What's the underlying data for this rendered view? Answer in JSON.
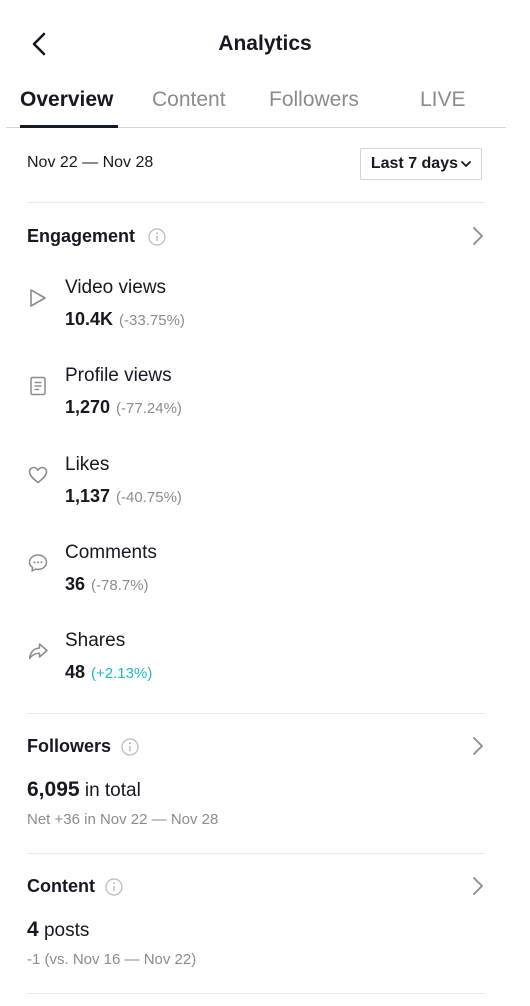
{
  "header": {
    "title": "Analytics",
    "back_icon": "chevron-left-icon"
  },
  "tabs": [
    {
      "label": "Overview",
      "active": true
    },
    {
      "label": "Content",
      "active": false
    },
    {
      "label": "Followers",
      "active": false
    },
    {
      "label": "LIVE",
      "active": false
    }
  ],
  "date_filter": {
    "range": "Nov 22 — Nov 28",
    "period": "Last 7 days"
  },
  "engagement": {
    "title": "Engagement",
    "metrics": [
      {
        "icon": "play-icon",
        "label": "Video views",
        "value": "10.4K",
        "change": "(-33.75%)"
      },
      {
        "icon": "profile-doc-icon",
        "label": "Profile views",
        "value": "1,270",
        "change": "(-77.24%)"
      },
      {
        "icon": "heart-icon",
        "label": "Likes",
        "value": "1,137",
        "change": "(-40.75%)"
      },
      {
        "icon": "comment-icon",
        "label": "Comments",
        "value": "36",
        "change": "(-78.7%)"
      },
      {
        "icon": "share-icon",
        "label": "Shares",
        "value": "48",
        "change": "(+2.13%)"
      }
    ]
  },
  "followers": {
    "title": "Followers",
    "total_value": "6,095",
    "total_suffix": " in total",
    "net": "Net +36 in Nov 22 — Nov 28"
  },
  "content": {
    "title": "Content",
    "posts_value": "4",
    "posts_suffix": " posts",
    "comparison": "-1 (vs. Nov 16 — Nov 22)"
  },
  "colors": {
    "text": "#161823",
    "muted": "#8a8b91",
    "positive": "#20b8c4",
    "divider": "#ebebec"
  }
}
